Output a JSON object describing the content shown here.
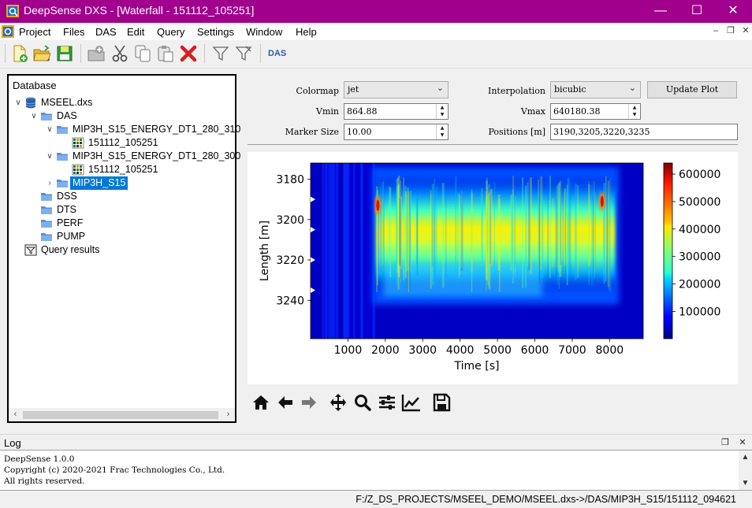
{
  "window": {
    "app_name": "DeepSense DXS",
    "title": "DeepSense DXS - [Waterfall - 151112_105251]",
    "minimize": "—",
    "maximize": "☐",
    "close": "✕",
    "accent": "#a0008c"
  },
  "menubar": {
    "items": [
      "Project",
      "Files",
      "DAS",
      "Edit",
      "Query",
      "Settings",
      "Window",
      "Help"
    ],
    "mdi_minimize": "–",
    "mdi_restore": "❐",
    "mdi_close": "✕"
  },
  "toolbar": {
    "buttons": [
      "new-file-icon",
      "open-folder-icon",
      "save-icon",
      "add-item-icon",
      "cut-icon",
      "copy-icon",
      "paste-icon",
      "delete-icon",
      "filter-icon",
      "filter-options-icon"
    ],
    "mode_label": "DAS"
  },
  "database": {
    "title": "Database",
    "tree": [
      {
        "label": "MSEEL.dxs",
        "icon": "database-icon",
        "level": 0,
        "expanded": true
      },
      {
        "label": "DAS",
        "icon": "folder-icon",
        "level": 1,
        "expanded": true
      },
      {
        "label": "MIP3H_S15_ENERGY_DT1_280_310",
        "icon": "folder-icon",
        "level": 2,
        "expanded": true
      },
      {
        "label": "151112_105251",
        "icon": "grid-data-icon",
        "level": 3
      },
      {
        "label": "MIP3H_S15_ENERGY_DT1_280_300",
        "icon": "folder-icon",
        "level": 2,
        "expanded": true
      },
      {
        "label": "151112_105251",
        "icon": "grid-data-icon",
        "level": 3
      },
      {
        "label": "MIP3H_S15",
        "icon": "folder-icon",
        "level": 2,
        "expanded": false,
        "selected": true
      },
      {
        "label": "DSS",
        "icon": "folder-icon",
        "level": 1
      },
      {
        "label": "DTS",
        "icon": "folder-icon",
        "level": 1
      },
      {
        "label": "PERF",
        "icon": "folder-icon",
        "level": 1
      },
      {
        "label": "PUMP",
        "icon": "folder-icon",
        "level": 1
      },
      {
        "label": "Query results",
        "icon": "query-icon",
        "level": 0
      }
    ]
  },
  "controls": {
    "colormap_label": "Colormap",
    "colormap_value": "jet",
    "interpolation_label": "Interpolation",
    "interpolation_value": "bicubic",
    "update_label": "Update Plot",
    "vmin_label": "Vmin",
    "vmin_value": "864.88",
    "vmax_label": "Vmax",
    "vmax_value": "640180.38",
    "marker_label": "Marker Size",
    "marker_value": "10.00",
    "positions_label": "Positions [m]",
    "positions_value": "3190,3205,3220,3235"
  },
  "chart_data": {
    "type": "heatmap",
    "colormap": "jet",
    "xlabel": "Time [s]",
    "ylabel": "Length [m]",
    "xticks": [
      1000,
      2000,
      3000,
      4000,
      5000,
      6000,
      7000,
      8000
    ],
    "yticks": [
      3180,
      3200,
      3220,
      3240
    ],
    "xlim": [
      0,
      8900
    ],
    "ylim": [
      3259,
      3172
    ],
    "colorbar_ticks": [
      "100000",
      "200000",
      "300000",
      "400000",
      "500000",
      "600000"
    ],
    "vmin": 864.88,
    "vmax": 640180.38,
    "markers_y": [
      3190,
      3205,
      3220,
      3235
    ],
    "active_period": [
      1750,
      8150
    ],
    "energy_band": [
      3178,
      3236
    ],
    "peak_depth": 3205,
    "notes_hotspots": [
      {
        "t": 1800,
        "depth": 3193
      },
      {
        "t": 7800,
        "depth": 3191
      }
    ]
  },
  "mpl_toolbar": [
    "home-icon",
    "back-icon",
    "forward-icon",
    "pan-icon",
    "zoom-icon",
    "configure-icon",
    "edit-axes-icon",
    "save-figure-icon"
  ],
  "log": {
    "title": "Log",
    "lines": [
      "DeepSense 1.0.0",
      "Copyright (c) 2020-2021 Frac Technologies Co., Ltd.",
      "All rights reserved."
    ]
  },
  "status": {
    "path": "F:/Z_DS_PROJECTS/MSEEL_DEMO/MSEEL.dxs->/DAS/MIP3H_S15/151112_094621"
  }
}
